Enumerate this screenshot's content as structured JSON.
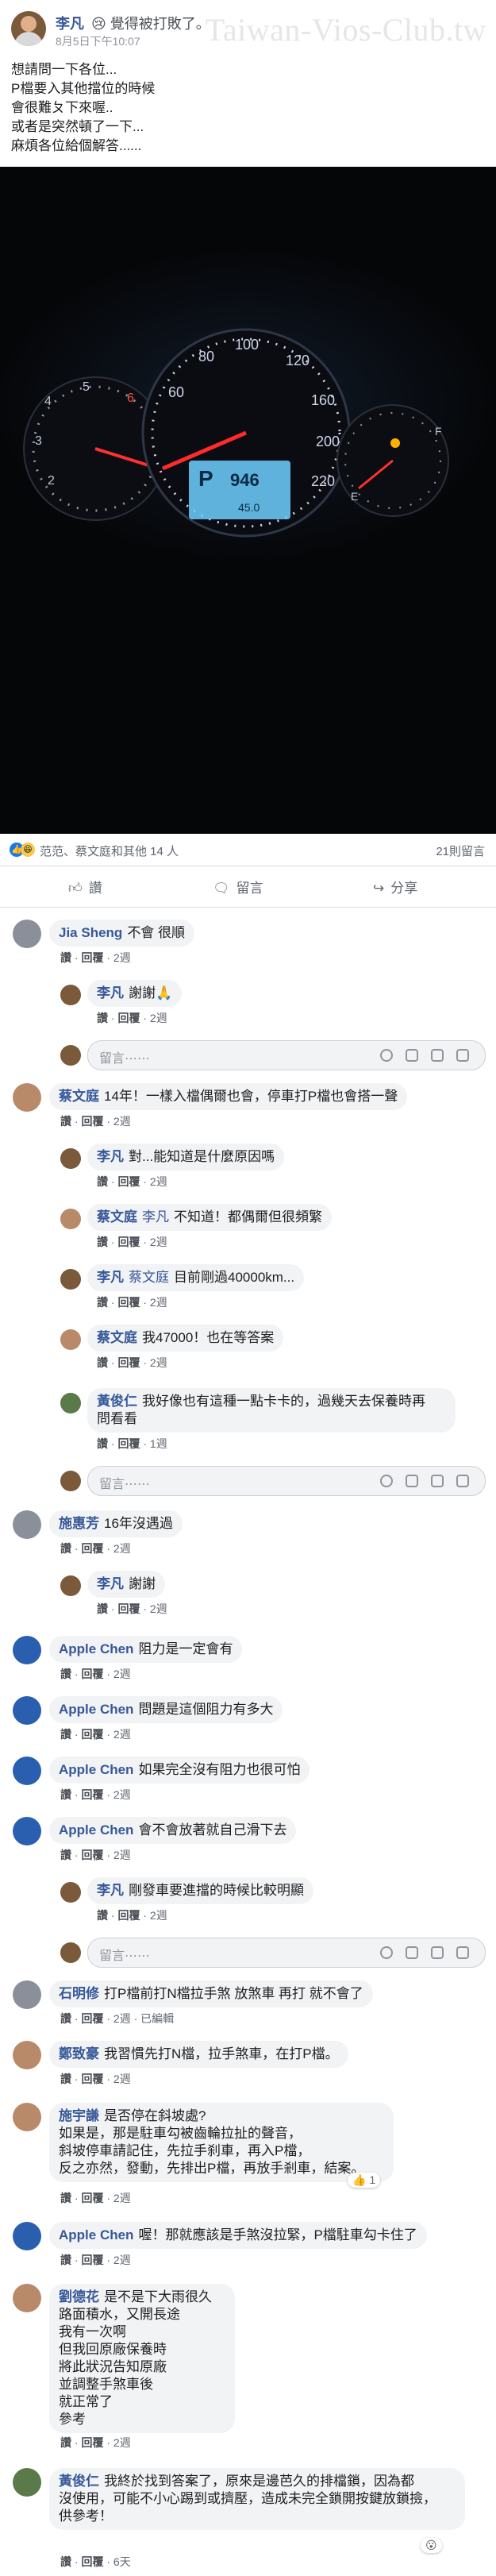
{
  "post": {
    "author": "李凡",
    "feeling": "😢 覺得被打敗了。",
    "date": "8月5日下午10:07",
    "watermark": "Taiwan-Vios-Club.tw",
    "lines": [
      "想請問一下各位...",
      "P檔要入其他擋位的時候",
      "會很難ㄆ下來喔..",
      "或者是突然頓了一下...",
      "麻煩各位給個解答......"
    ]
  },
  "dashboard": {
    "odo_letter": "P",
    "odo_value": "946",
    "trip": "45.0"
  },
  "reactions": {
    "summary": "范范、蔡文庭和其他 14 人",
    "comment_count": "21則留言"
  },
  "action_bar": {
    "like": "讚",
    "comment": "留言",
    "share": "分享"
  },
  "labels": {
    "like": "讚",
    "reply": "回覆",
    "edited": "已編輯",
    "placeholder": "留言⋯⋯"
  },
  "comments": [
    {
      "id": "c1",
      "name": "Jia Sheng",
      "text": "不會 很順",
      "time": "2週"
    },
    {
      "id": "r1",
      "name": "李凡",
      "text": "謝謝🙏",
      "time": "2週"
    },
    {
      "id": "c2",
      "name": "蔡文庭",
      "text": "14年！一樣入檔偶爾也會，停車打P檔也會搭一聲",
      "time": "2週"
    },
    {
      "id": "r2",
      "name": "李凡",
      "text": "對...能知道是什麼原因嗎",
      "time": "2週"
    },
    {
      "id": "r3",
      "name": "蔡文庭",
      "mention": "李凡",
      "text": "不知道！都偶爾但很頻繁",
      "time": "2週"
    },
    {
      "id": "r4",
      "name": "李凡",
      "mention": "蔡文庭",
      "text": "目前剛過40000km...",
      "time": "2週"
    },
    {
      "id": "r5",
      "name": "蔡文庭",
      "text": "我47000！也在等答案",
      "time": "2週"
    },
    {
      "id": "r6",
      "name": "黃俊仁",
      "text1": "我好像也有這種一點卡卡的，過幾天去保養時再",
      "text2": "問看看",
      "time": "1週"
    },
    {
      "id": "c3",
      "name": "施惠芳",
      "text": "16年沒遇過",
      "time": "2週"
    },
    {
      "id": "r7",
      "name": "李凡",
      "text": "謝謝",
      "time": "2週"
    },
    {
      "id": "c4",
      "name": "Apple Chen",
      "text": "阻力是一定會有",
      "time": "2週"
    },
    {
      "id": "c5",
      "name": "Apple Chen",
      "text": "問題是這個阻力有多大",
      "time": "2週"
    },
    {
      "id": "c6",
      "name": "Apple Chen",
      "text": "如果完全沒有阻力也很可怕",
      "time": "2週"
    },
    {
      "id": "c7",
      "name": "Apple Chen",
      "text": "會不會放著就自己滑下去",
      "time": "2週"
    },
    {
      "id": "r8",
      "name": "李凡",
      "text": "剛發車要進擋的時候比較明顯",
      "time": "2週"
    },
    {
      "id": "c8",
      "name": "石明修",
      "text": "打P檔前打N檔拉手煞 放煞車 再打 就不會了",
      "time": "2週"
    },
    {
      "id": "c9",
      "name": "鄭致豪",
      "text": "我習慣先打N檔，拉手煞車，在打P檔。",
      "time": "2週"
    },
    {
      "id": "c10",
      "name": "施宇謙",
      "head": "是否停在斜坡處?",
      "lines": [
        "如果是，那是駐車勾被齒輪拉扯的聲音，",
        "斜坡停車請記住，先拉手刹車，再入P檔，",
        "反之亦然，發動，先排出P檔，再放手剎車，結案。"
      ],
      "time": "2週",
      "likes": "1"
    },
    {
      "id": "c11",
      "name": "Apple Chen",
      "text": "喔！那就應該是手煞沒拉緊，P檔駐車勾卡住了",
      "time": "2週"
    },
    {
      "id": "c12",
      "name": "劉德花",
      "head": "是不是下大雨很久",
      "lines": [
        "路面積水，又開長途",
        "我有一次啊",
        "但我回原廠保養時",
        "將此狀況告知原廠",
        "並調整手煞車後",
        "就正常了",
        "參考"
      ],
      "time": "2週"
    },
    {
      "id": "c13",
      "name": "黃俊仁",
      "text1": "我終於找到答案了，原來是邊芭久的排檔鎖，因為都",
      "text2": "沒使用，可能不小心踢到或擠壓，造成未完全鎖開按鍵放鎖撿，",
      "text3": "供參考！",
      "time": "6天"
    }
  ]
}
